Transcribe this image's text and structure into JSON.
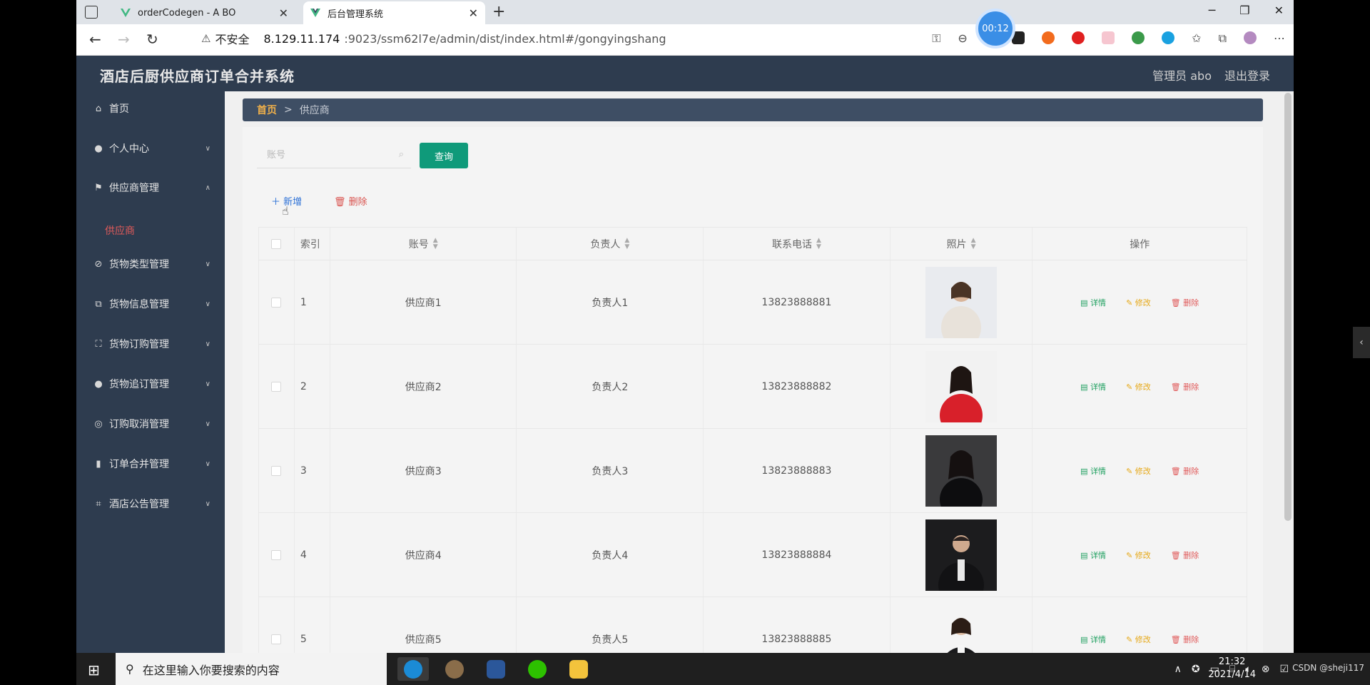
{
  "browser": {
    "tabs": [
      {
        "label": "orderCodegen - A BO",
        "active": false
      },
      {
        "label": "后台管理系统",
        "active": true
      }
    ],
    "timer": "00:12",
    "insecure_label": "不安全",
    "url_host": "8.129.11.174",
    "url_rest": ":9023/ssm62l7e/admin/dist/index.html#/gongyingshang"
  },
  "app": {
    "title": "酒店后厨供应商订单合并系统",
    "user": "管理员 abo",
    "logout": "退出登录"
  },
  "sidebar": {
    "items": [
      {
        "label": "首页",
        "icon": "home-icon"
      },
      {
        "label": "个人中心",
        "icon": "user-icon"
      },
      {
        "label": "供应商管理",
        "icon": "flag-icon"
      },
      {
        "label": "货物类型管理",
        "icon": "settings-icon"
      },
      {
        "label": "货物信息管理",
        "icon": "copy-icon"
      },
      {
        "label": "货物订购管理",
        "icon": "fullscreen-icon"
      },
      {
        "label": "货物追订管理",
        "icon": "user-solid-icon"
      },
      {
        "label": "订购取消管理",
        "icon": "circle-icon"
      },
      {
        "label": "订单合并管理",
        "icon": "chart-icon"
      },
      {
        "label": "酒店公告管理",
        "icon": "crop-icon"
      }
    ],
    "sub_active": "供应商"
  },
  "breadcrumb": {
    "home": "首页",
    "sep": ">",
    "current": "供应商"
  },
  "toolbar": {
    "search_placeholder": "账号",
    "query": "查询",
    "add": "新增",
    "delete": "删除"
  },
  "table": {
    "headers": {
      "index": "索引",
      "account": "账号",
      "person": "负责人",
      "phone": "联系电话",
      "photo": "照片",
      "ops": "操作"
    },
    "rows": [
      {
        "index": "1",
        "account": "供应商1",
        "person": "负责人1",
        "phone": "13823888881"
      },
      {
        "index": "2",
        "account": "供应商2",
        "person": "负责人2",
        "phone": "13823888882"
      },
      {
        "index": "3",
        "account": "供应商3",
        "person": "负责人3",
        "phone": "13823888883"
      },
      {
        "index": "4",
        "account": "供应商4",
        "person": "负责人4",
        "phone": "13823888884"
      },
      {
        "index": "5",
        "account": "供应商5",
        "person": "负责人5",
        "phone": "13823888885"
      }
    ],
    "op_labels": {
      "detail": "详情",
      "edit": "修改",
      "delete": "删除"
    }
  },
  "taskbar": {
    "search_placeholder": "在这里输入你要搜索的内容",
    "time": "21:32",
    "date": "2021/4/14",
    "watermark": "CSDN @sheji117"
  },
  "colors": {
    "sidebar": "#2e3c4f",
    "primary": "#0f9a7a",
    "accent": "#f0b04a"
  }
}
